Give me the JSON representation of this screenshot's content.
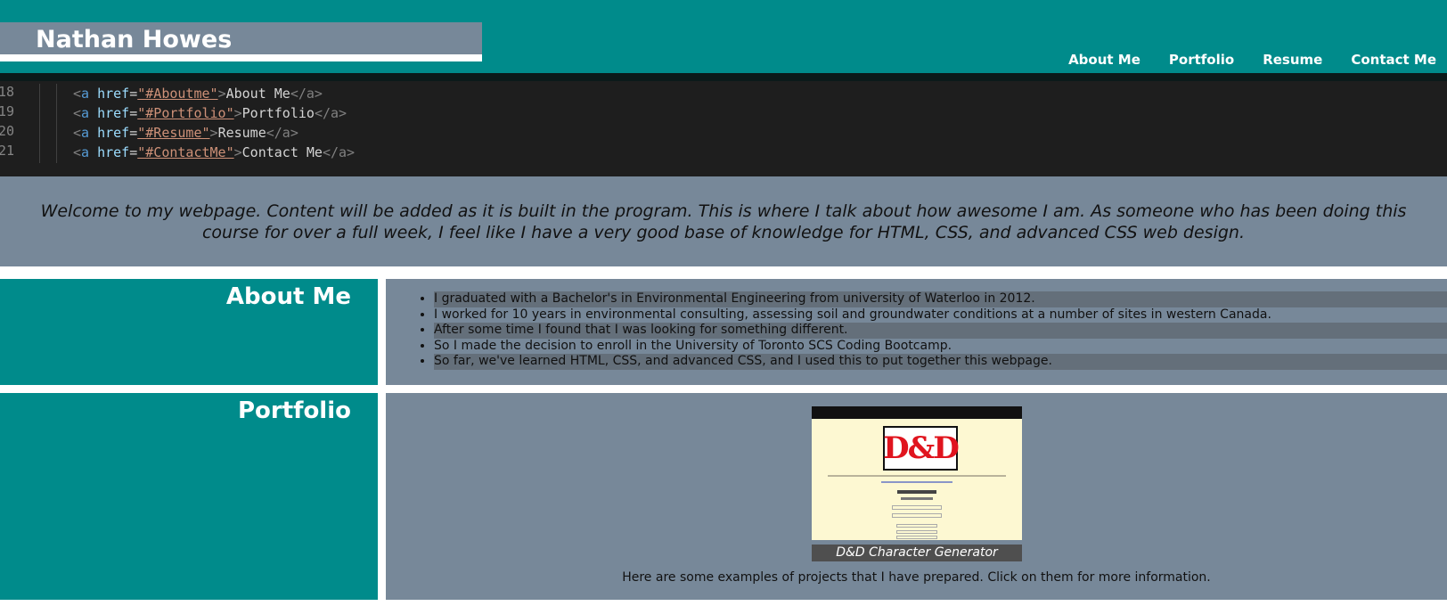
{
  "header": {
    "name": "Nathan Howes",
    "nav": [
      "About Me",
      "Portfolio",
      "Resume",
      "Contact Me"
    ]
  },
  "hero_code": {
    "lines": [
      {
        "num": "18",
        "href": "\"#Aboutme\"",
        "text": "About Me"
      },
      {
        "num": "19",
        "href": "\"#Portfolio\"",
        "text": "Portfolio"
      },
      {
        "num": "20",
        "href": "\"#Resume\"",
        "text": "Resume"
      },
      {
        "num": "21",
        "href": "\"#ContactMe\"",
        "text": "Contact Me"
      }
    ],
    "tag_open": "<",
    "tag_name": "a",
    "attr_name": "href",
    "equals": "=",
    "tag_close": ">",
    "end_tag": "</a>"
  },
  "welcome": {
    "text": "Welcome to my webpage. Content will be added as it is built in the program. This is where I talk about how awesome I am. As someone who has been doing this course for over a full week, I feel like I have a very good base of knowledge for HTML, CSS, and advanced CSS web design."
  },
  "about": {
    "heading": "About Me",
    "items": [
      "I graduated with a Bachelor's in Environmental Engineering from university of Waterloo in 2012.",
      "I worked for 10 years in environmental consulting, assessing soil and groundwater conditions at a number of sites in western Canada.",
      "After some time I found that I was looking for something different.",
      "So I made the decision to enroll in the University of Toronto SCS Coding Bootcamp.",
      "So far, we've learned HTML, CSS, and advanced CSS, and I used this to put together this webpage."
    ]
  },
  "portfolio": {
    "heading": "Portfolio",
    "project": {
      "thumb_title": "D&D 5e CHARACTER GENERATOR",
      "logo": "D&D",
      "caption": "D&D Character Generator"
    },
    "text": "Here are some examples of projects that I have prepared. Click on them for more information."
  },
  "colors": {
    "teal": "#008b8b",
    "slate": "#778899",
    "highlight": "#646f7a",
    "code_bg": "#1e1e1e"
  }
}
